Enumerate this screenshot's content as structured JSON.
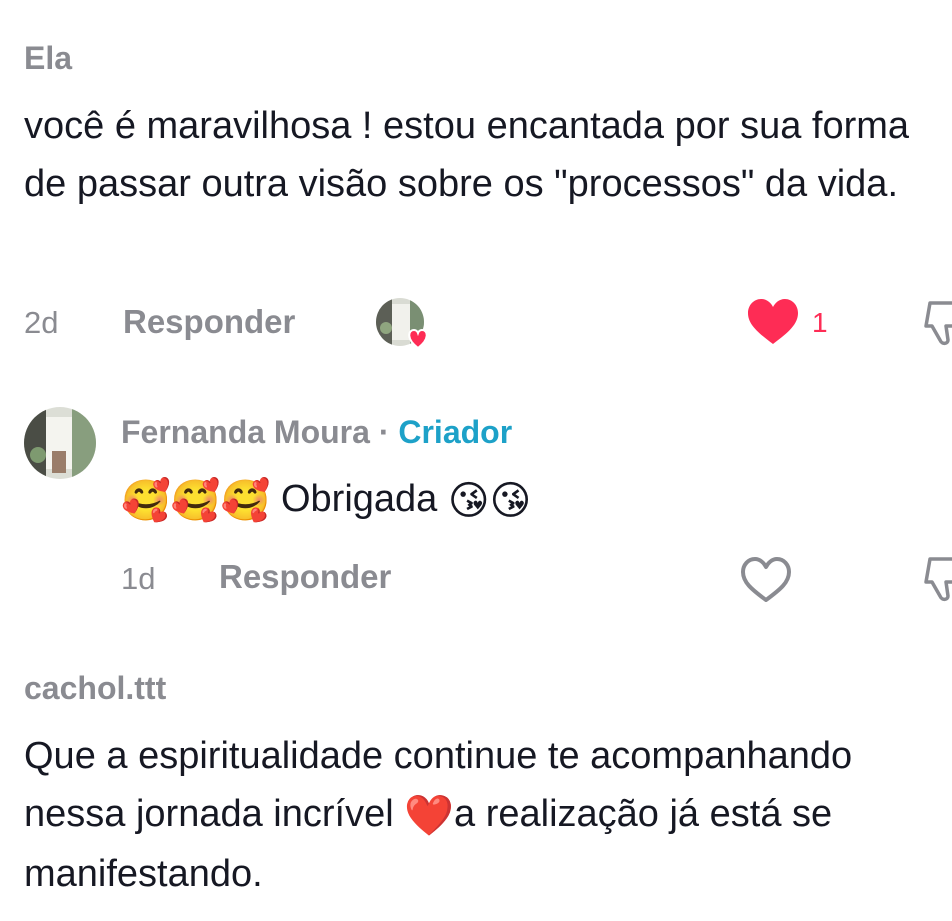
{
  "comments": [
    {
      "username": "Ela",
      "text": "você é maravilhosa ! estou encantada por sua forma de passar outra visão sobre os \"processos\" da vida.",
      "time": "2d",
      "reply_label": "Responder",
      "like_count": "1",
      "liked": true,
      "liked_by_creator_icon": "avatar-with-heart-icon"
    },
    {
      "username": "Fernanda Moura",
      "separator": "·",
      "creator_label": "Criador",
      "text_prefix_emojis": "🥰🥰🥰",
      "text_main": " Obrigada ",
      "text_suffix_emojis": "😘😘",
      "time": "1d",
      "reply_label": "Responder",
      "liked": false
    },
    {
      "username": "cachol.ttt",
      "text_part1": "Que a espiritualidade continue te acompanhando nessa jornada incrível ",
      "heart_emoji": "❤️",
      "text_part2": "a realização já está se manifestando."
    }
  ],
  "colors": {
    "like_red": "#fe2c55",
    "creator_blue": "#1da1c8",
    "muted_gray": "#8a8b91",
    "text": "#161823"
  }
}
